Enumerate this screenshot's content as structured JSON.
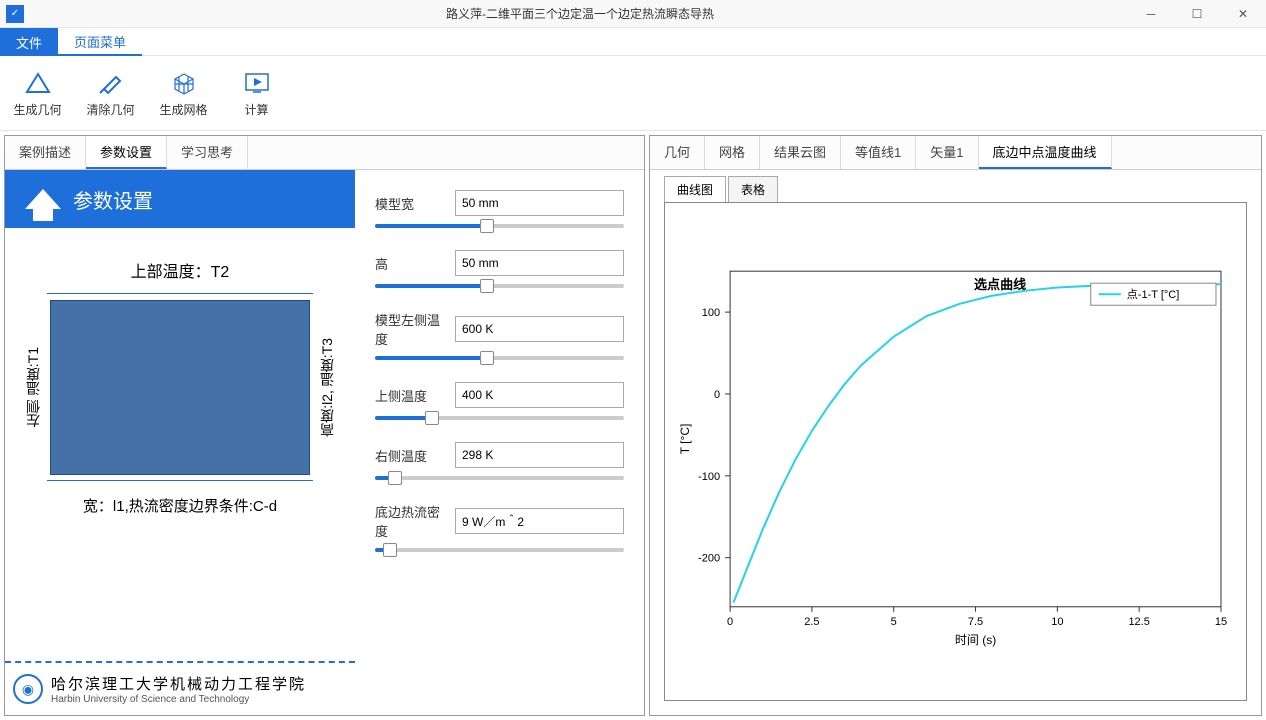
{
  "window": {
    "title": "路义萍-二维平面三个边定温一个边定热流瞬态导热"
  },
  "menu": {
    "file": "文件",
    "page": "页面菜单"
  },
  "ribbon": {
    "gen_geom": "生成几何",
    "clear_geom": "清除几何",
    "gen_mesh": "生成网格",
    "compute": "计算"
  },
  "left_tabs": {
    "case_desc": "案例描述",
    "param_set": "参数设置",
    "study": "学习思考"
  },
  "right_tabs": {
    "geom": "几何",
    "mesh": "网格",
    "result_cloud": "结果云图",
    "contour1": "等值线1",
    "vector1": "矢量1",
    "bottom_curve": "底边中点温度曲线"
  },
  "sub_tabs": {
    "curve": "曲线图",
    "table": "表格"
  },
  "param_header": "参数设置",
  "diagram": {
    "top": "上部温度：T2",
    "left": "左侧 温度:T1",
    "right": "高度:l2, 温度:T3",
    "bottom": "宽：l1,热流密度边界条件:C-d"
  },
  "params": {
    "width": {
      "label": "模型宽",
      "value": "50 mm",
      "pct": 45
    },
    "height": {
      "label": "高",
      "value": "50 mm",
      "pct": 45
    },
    "t_left": {
      "label": "模型左侧温度",
      "value": "600 K",
      "pct": 45
    },
    "t_top": {
      "label": "上侧温度",
      "value": "400 K",
      "pct": 23
    },
    "t_right": {
      "label": "右侧温度",
      "value": "298 K",
      "pct": 8
    },
    "q_bot": {
      "label": "底边热流密度",
      "value": "9 W／m＾2",
      "pct": 6
    }
  },
  "logo": {
    "cn": "哈尔滨理工大学机械动力工程学院",
    "en": "Harbin University of Science and Technology"
  },
  "chart_data": {
    "type": "line",
    "title": "选点曲线",
    "xlabel": "时间 (s)",
    "ylabel": "T [°C]",
    "xlim": [
      0,
      15
    ],
    "ylim": [
      -260,
      150
    ],
    "xticks": [
      0,
      2.5,
      5,
      7.5,
      10,
      12.5,
      15
    ],
    "yticks": [
      -200,
      -100,
      0,
      100
    ],
    "series": [
      {
        "name": "点-1-T [°C]",
        "color": "#22d3ee",
        "x": [
          0.1,
          0.3,
          0.6,
          1.0,
          1.5,
          2.0,
          2.5,
          3.0,
          3.5,
          4.0,
          5.0,
          6.0,
          7.0,
          8.0,
          9.0,
          10.0,
          11.0,
          12.0,
          13.0,
          14.0,
          15.0
        ],
        "y": [
          -255,
          -235,
          -205,
          -165,
          -120,
          -80,
          -45,
          -15,
          12,
          35,
          70,
          95,
          110,
          120,
          126,
          130,
          132,
          133,
          134,
          134,
          134
        ]
      }
    ]
  }
}
